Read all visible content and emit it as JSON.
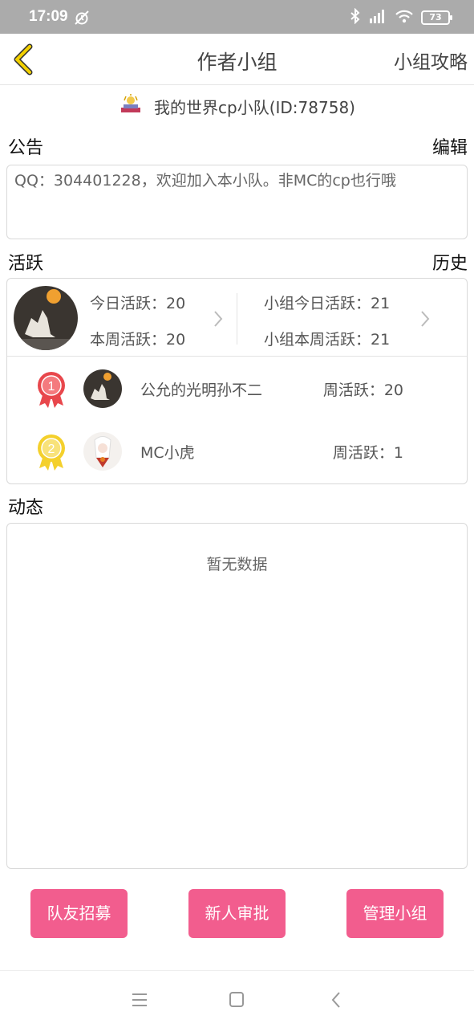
{
  "status_bar": {
    "time": "17:09",
    "battery": "73"
  },
  "header": {
    "title": "作者小组",
    "guide_label": "小组攻略"
  },
  "group": {
    "name": "我的世界cp小队(ID:78758)"
  },
  "notice": {
    "label": "公告",
    "edit_label": "编辑",
    "text": "QQ：304401228，欢迎加入本小队。非MC的cp也行哦"
  },
  "activity": {
    "label": "活跃",
    "history_label": "历史",
    "my_today": "今日活跃：20",
    "my_week": "本周活跃：20",
    "group_today": "小组今日活跃：21",
    "group_week": "小组本周活跃：21",
    "ranking": [
      {
        "rank": "1",
        "name": "公允的光明孙不二",
        "stat": "周活跃：20"
      },
      {
        "rank": "2",
        "name": "MC小虎",
        "stat": "周活跃：1"
      }
    ]
  },
  "dynamics": {
    "label": "动态",
    "empty_text": "暂无数据"
  },
  "buttons": {
    "recruit": "队友招募",
    "approve": "新人审批",
    "manage": "管理小组"
  },
  "colors": {
    "accent_pink": "#f25d8e",
    "back_arrow": "#f2d000",
    "medal_gold": "#f4d02c",
    "medal_red": "#e8474c"
  }
}
